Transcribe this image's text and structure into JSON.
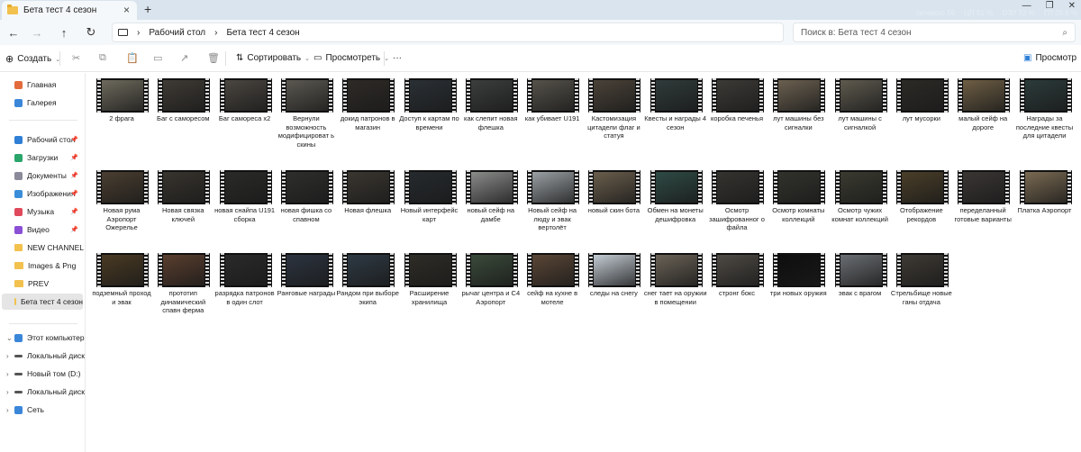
{
  "tab": {
    "title": "Бета тест 4 сезон",
    "close": "×",
    "new": "+"
  },
  "sysinfo": [
    "сетевого  59",
    "ЦП  51 %",
    "ОЗУ  72 %",
    "ГП  20.6 %"
  ],
  "window_controls": {
    "minimize": "—",
    "maximize": "❐",
    "close": "✕"
  },
  "nav": {
    "back": "←",
    "forward": "→",
    "up": "↑",
    "refresh": "↻"
  },
  "address": {
    "sep": "›",
    "crumbs": [
      "Рабочий стол",
      "Бета тест 4 сезон"
    ]
  },
  "search": {
    "placeholder": "Поиск в: Бета тест 4 сезон",
    "icon": "⌕"
  },
  "toolbar": {
    "create": "Создать",
    "sort": "Сортировать",
    "view": "Просмотреть",
    "more": "···",
    "preview": "Просмотр"
  },
  "sidebar": {
    "top": [
      {
        "label": "Главная",
        "color": "#e36b3b"
      },
      {
        "label": "Галерея",
        "color": "#3a87d9"
      }
    ],
    "quick": [
      {
        "label": "Рабочий стол",
        "color": "#2f7fd6"
      },
      {
        "label": "Загрузки",
        "color": "#2aa56b"
      },
      {
        "label": "Документы",
        "color": "#8a8a9a"
      },
      {
        "label": "Изображения",
        "color": "#3a8ed9"
      },
      {
        "label": "Музыка",
        "color": "#e0495b"
      },
      {
        "label": "Видео",
        "color": "#8b4fd6"
      },
      {
        "label": "NEW CHANNEL",
        "color": "#f2c14e"
      },
      {
        "label": "Images & Png",
        "color": "#f2c14e"
      },
      {
        "label": "PREV",
        "color": "#f2c14e"
      },
      {
        "label": "Бета тест 4 сезон",
        "color": "#f2c14e"
      }
    ],
    "pc": {
      "label": "Этот компьютер"
    },
    "drives": [
      {
        "label": "Локальный диск"
      },
      {
        "label": "Новый том (D:)"
      },
      {
        "label": "Локальный диск"
      }
    ],
    "network": {
      "label": "Сеть"
    }
  },
  "files": [
    {
      "name": "2 фрага",
      "tone": "#6d6a5c"
    },
    {
      "name": "Баг с саморесом",
      "tone": "#3f3b35"
    },
    {
      "name": "Баг самореса x2",
      "tone": "#4a4640"
    },
    {
      "name": "Вернули возможность модифицироват ь скины",
      "tone": "#5a5850"
    },
    {
      "name": "докид патронов в магазин",
      "tone": "#2e2a26"
    },
    {
      "name": "Доступ к картам по времени",
      "tone": "#2a3035"
    },
    {
      "name": "как слепит новая флешка",
      "tone": "#3a3e3c"
    },
    {
      "name": "как убивает U191",
      "tone": "#55524a"
    },
    {
      "name": "Кастомизация цитадели флаг и статуя",
      "tone": "#4a4238"
    },
    {
      "name": "Квесты и награды 4 сезон",
      "tone": "#2f3b3a"
    },
    {
      "name": "коробка печенья",
      "tone": "#3c3a36"
    },
    {
      "name": "лут машины без сигналки",
      "tone": "#6b6050"
    },
    {
      "name": "лут машины с сигналкой",
      "tone": "#5e5a4e"
    },
    {
      "name": "лут мусорки",
      "tone": "#2c2a26"
    },
    {
      "name": "малый сейф на дороге",
      "tone": "#6e5e44"
    },
    {
      "name": "Награды за последние квесты для цитадели",
      "tone": "#2b3b3a"
    },
    {
      "name": "Новая рума Аэропорт Ожерелье",
      "tone": "#4a3e30"
    },
    {
      "name": "Новая связка ключей",
      "tone": "#38342e"
    },
    {
      "name": "новая снайпа U191 сборка",
      "tone": "#2a2a28"
    },
    {
      "name": "новая фишка со спавном",
      "tone": "#2e2e2c"
    },
    {
      "name": "Новая флешка",
      "tone": "#3a3630"
    },
    {
      "name": "Новый интерфейс карт",
      "tone": "#252a2e"
    },
    {
      "name": "новый сейф на дамбе",
      "tone": "#8a8c8a"
    },
    {
      "name": "Новый сейф на люду и эвак вертолёт",
      "tone": "#9aa0a4"
    },
    {
      "name": "новый скин бота",
      "tone": "#6a5e4c"
    },
    {
      "name": "Обмен на монеты дешифровка",
      "tone": "#2e4a44"
    },
    {
      "name": "Осмотр зашифрованног о файла",
      "tone": "#34332f"
    },
    {
      "name": "Осмотр комнаты коллекций",
      "tone": "#32322c"
    },
    {
      "name": "Осмотр чужих комнат коллекций",
      "tone": "#3a3a30"
    },
    {
      "name": "Отображение рекордов",
      "tone": "#4a3e28"
    },
    {
      "name": "переделанный готовые варианты",
      "tone": "#3a3634"
    },
    {
      "name": "Платка Аэропорт",
      "tone": "#7a6a52"
    },
    {
      "name": "подземный проход и эвак",
      "tone": "#4a3a22"
    },
    {
      "name": "прототип динамический спавн ферма",
      "tone": "#5a3e2e"
    },
    {
      "name": "разрядка патронов в один слот",
      "tone": "#2a2a2a"
    },
    {
      "name": "Ранговые награды",
      "tone": "#2c3440"
    },
    {
      "name": "Рандом при выборе экипа",
      "tone": "#2e3a44"
    },
    {
      "name": "Расширение хранилища",
      "tone": "#2e2c26"
    },
    {
      "name": "рычаг центра и C4 Аэропорт",
      "tone": "#3a4a3a"
    },
    {
      "name": "сейф на кухне в мотеле",
      "tone": "#5a4636"
    },
    {
      "name": "следы на снегу",
      "tone": "#c4ccd4"
    },
    {
      "name": "снег тает на оружии в помещении",
      "tone": "#6a6256"
    },
    {
      "name": "стронг бокс",
      "tone": "#4e4a44"
    },
    {
      "name": "три новых оружия",
      "tone": "#0e0e0e"
    },
    {
      "name": "эвак с врагом",
      "tone": "#6a6e72"
    },
    {
      "name": "Стрельбище новые ганы отдача",
      "tone": "#3e3a34"
    }
  ]
}
